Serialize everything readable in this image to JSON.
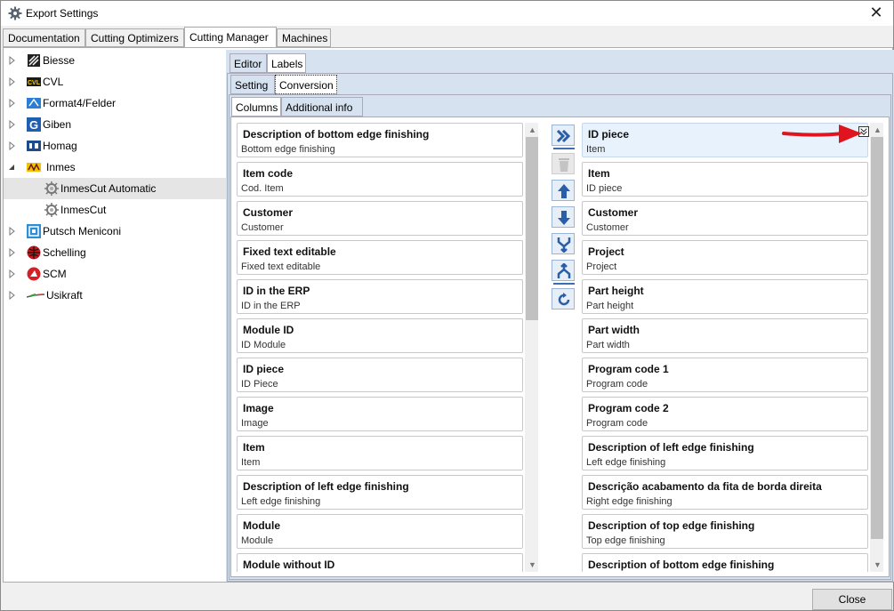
{
  "window": {
    "title": "Export Settings",
    "close_glyph": "✕"
  },
  "main_tabs": [
    {
      "label": "Documentation",
      "active": false
    },
    {
      "label": "Cutting Optimizers",
      "active": false
    },
    {
      "label": "Cutting Manager",
      "active": true
    },
    {
      "label": "Machines",
      "active": false
    }
  ],
  "tree": [
    {
      "label": "Biesse",
      "icon": "biesse-icon",
      "expander": "collapsed"
    },
    {
      "label": "CVL",
      "icon": "cvl-icon",
      "expander": "collapsed"
    },
    {
      "label": "Format4/Felder",
      "icon": "format4-icon",
      "expander": "collapsed"
    },
    {
      "label": "Giben",
      "icon": "giben-icon",
      "expander": "collapsed"
    },
    {
      "label": "Homag",
      "icon": "homag-icon",
      "expander": "collapsed"
    },
    {
      "label": "Inmes",
      "icon": "inmes-icon",
      "expander": "expanded"
    },
    {
      "label": "InmesCut Automatic",
      "icon": "gear-icon",
      "expander": "none",
      "selected": true
    },
    {
      "label": "InmesCut",
      "icon": "gear-icon",
      "expander": "none"
    },
    {
      "label": "Putsch Meniconi",
      "icon": "putsch-icon",
      "expander": "collapsed"
    },
    {
      "label": "Schelling",
      "icon": "schelling-icon",
      "expander": "collapsed"
    },
    {
      "label": "SCM",
      "icon": "scm-icon",
      "expander": "collapsed"
    },
    {
      "label": "Usikraft",
      "icon": "usikraft-icon",
      "expander": "collapsed"
    }
  ],
  "tabs_level1": [
    {
      "label": "Editor",
      "active": false
    },
    {
      "label": "Labels",
      "active": true
    }
  ],
  "tabs_level2": [
    {
      "label": "Setting",
      "active": false
    },
    {
      "label": "Conversion",
      "active": true
    }
  ],
  "tabs_level3": [
    {
      "label": "Columns",
      "active": true
    },
    {
      "label": "Additional info",
      "active": false
    }
  ],
  "available_columns": [
    {
      "title": "Description of bottom edge finishing",
      "sub": "Bottom edge finishing"
    },
    {
      "title": "Item code",
      "sub": "Cod. Item"
    },
    {
      "title": "Customer",
      "sub": "Customer"
    },
    {
      "title": "Fixed text editable",
      "sub": "Fixed text editable"
    },
    {
      "title": "ID in the ERP",
      "sub": "ID in the ERP"
    },
    {
      "title": "Module ID",
      "sub": "ID Module"
    },
    {
      "title": "ID piece",
      "sub": "ID Piece"
    },
    {
      "title": "Image",
      "sub": "Image"
    },
    {
      "title": "Item",
      "sub": "Item"
    },
    {
      "title": "Description of left edge finishing",
      "sub": "Left edge finishing"
    },
    {
      "title": "Module",
      "sub": "Module"
    },
    {
      "title": "Module without ID",
      "sub": ""
    }
  ],
  "selected_columns": [
    {
      "title": "ID piece",
      "sub": "Item",
      "selected": true
    },
    {
      "title": "Item",
      "sub": "ID piece"
    },
    {
      "title": "Customer",
      "sub": "Customer"
    },
    {
      "title": "Project",
      "sub": "Project"
    },
    {
      "title": "Part height",
      "sub": "Part height"
    },
    {
      "title": "Part width",
      "sub": "Part width"
    },
    {
      "title": "Program code 1",
      "sub": "Program code"
    },
    {
      "title": "Program code 2",
      "sub": "Program code"
    },
    {
      "title": "Description of left edge finishing",
      "sub": "Left edge finishing"
    },
    {
      "title": "Descrição acabamento da fita de borda direita",
      "sub": "Right edge finishing"
    },
    {
      "title": "Description of top edge finishing",
      "sub": "Top edge finishing"
    },
    {
      "title": "Description of bottom edge finishing",
      "sub": ""
    }
  ],
  "toolbar": [
    {
      "name": "add-columns-button",
      "icon": "double-chevron-right-icon",
      "enabled": true
    },
    {
      "name": "delete-button",
      "icon": "trash-icon",
      "enabled": false
    },
    {
      "name": "move-up-button",
      "icon": "arrow-up-icon",
      "enabled": true
    },
    {
      "name": "move-down-button",
      "icon": "arrow-down-icon",
      "enabled": true
    },
    {
      "name": "merge-button",
      "icon": "merge-icon",
      "enabled": true
    },
    {
      "name": "split-button",
      "icon": "split-icon",
      "enabled": true
    },
    {
      "name": "reset-button",
      "icon": "refresh-icon",
      "enabled": true
    }
  ],
  "footer": {
    "close_label": "Close"
  },
  "colors": {
    "accent": "#3a6fb4",
    "pane_bg": "#d6e2f0",
    "annotation_arrow": "#e0141e"
  }
}
